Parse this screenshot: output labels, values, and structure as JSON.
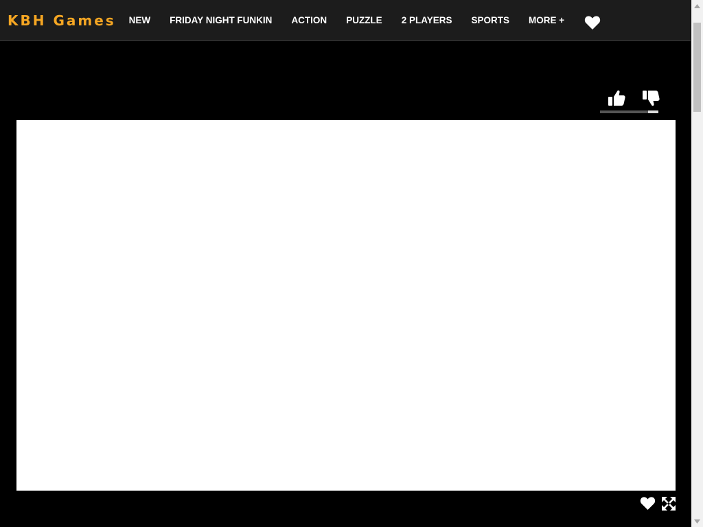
{
  "header": {
    "logo": "KBH Games",
    "nav_items": [
      {
        "label": "NEW"
      },
      {
        "label": "FRIDAY NIGHT FUNKIN"
      },
      {
        "label": "ACTION"
      },
      {
        "label": "PUZZLE"
      },
      {
        "label": "2 PLAYERS"
      },
      {
        "label": "SPORTS"
      },
      {
        "label": "MORE +"
      }
    ],
    "favorites_icon": "heart-icon"
  },
  "game": {
    "vote_up_icon": "thumbs-up-icon",
    "vote_down_icon": "thumbs-down-icon",
    "dislike_fraction": 0.18,
    "bottom_icons": [
      "heart-icon",
      "fullscreen-icon"
    ]
  },
  "colors": {
    "logo": "#f5a623",
    "navbar_bg": "#1c1c1c",
    "page_bg": "#000000",
    "game_bg": "#ffffff",
    "nav_text": "#ffffff"
  }
}
